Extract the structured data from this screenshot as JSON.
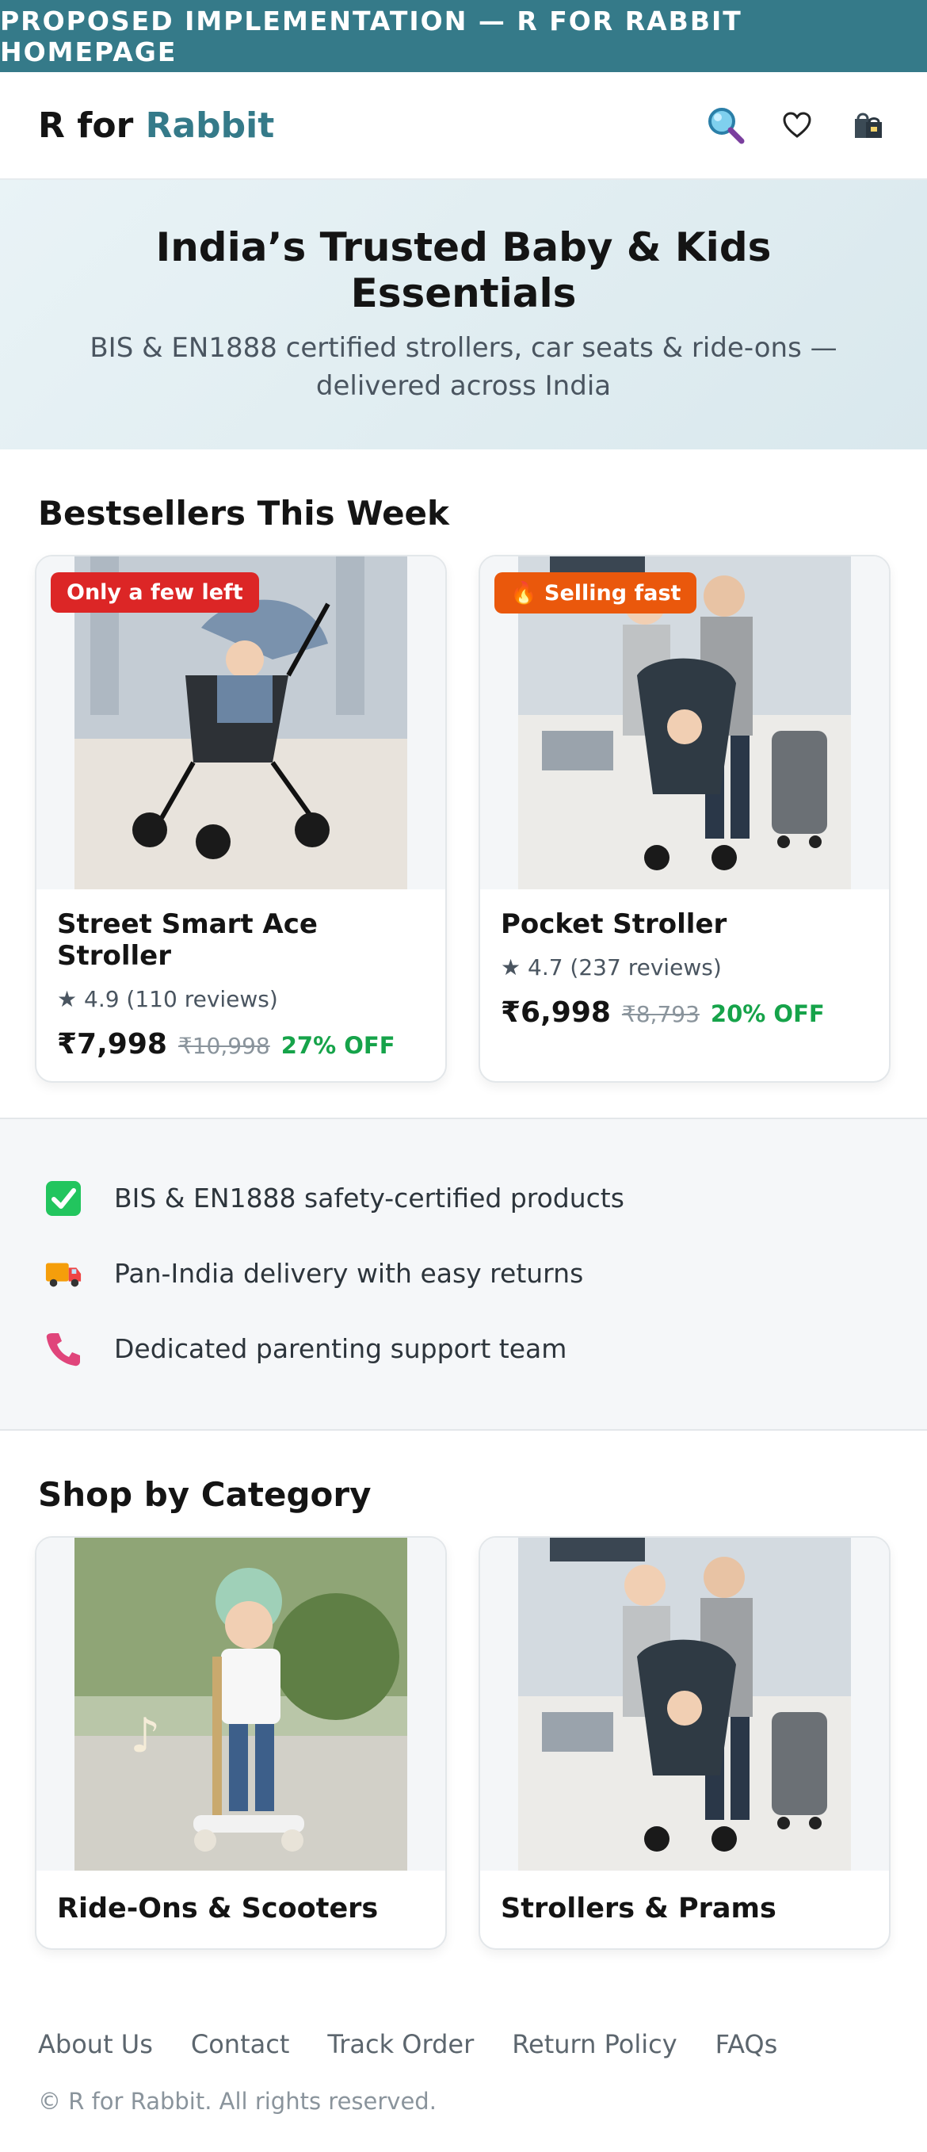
{
  "banner": {
    "text": "PROPOSED IMPLEMENTATION — R FOR RABBIT HOMEPAGE"
  },
  "header": {
    "logo_prefix": "R for ",
    "logo_accent": "Rabbit",
    "icons": [
      "search-icon",
      "heart-icon",
      "shopping-bag-icon"
    ]
  },
  "hero": {
    "title": "India’s Trusted Baby & Kids Essentials",
    "subtitle": "BIS & EN1888 certified strollers, car seats & ride-ons — delivered across India"
  },
  "bestsellers": {
    "title": "Bestsellers This Week",
    "products": [
      {
        "badge": "Only a few left",
        "badge_color": "#dc2626",
        "name": "Street Smart Ace Stroller",
        "rating": "★ 4.9 (110 reviews)",
        "price": "₹7,998",
        "mrp": "₹10,998",
        "discount": "27% OFF"
      },
      {
        "badge": "🔥 Selling fast",
        "badge_color": "#ea580c",
        "name": "Pocket Stroller",
        "rating": "★ 4.7 (237 reviews)",
        "price": "₹6,998",
        "mrp": "₹8,793",
        "discount": "20% OFF"
      }
    ]
  },
  "trust": {
    "items": [
      {
        "icon": "check-box-icon",
        "text": "BIS & EN1888 safety-certified products"
      },
      {
        "icon": "delivery-truck-icon",
        "text": "Pan-India delivery with easy returns"
      },
      {
        "icon": "phone-icon",
        "text": "Dedicated parenting support team"
      }
    ]
  },
  "categories": {
    "title": "Shop by Category",
    "items": [
      {
        "name": "Ride-Ons & Scooters"
      },
      {
        "name": "Strollers & Prams"
      }
    ]
  },
  "footer": {
    "links": [
      "About Us",
      "Contact",
      "Track Order",
      "Return Policy",
      "FAQs"
    ],
    "copyright": "© R for Rabbit. All rights reserved."
  },
  "colors": {
    "brand": "#357a89",
    "discount": "#16a34a",
    "badge_red": "#dc2626",
    "badge_orange": "#ea580c"
  }
}
